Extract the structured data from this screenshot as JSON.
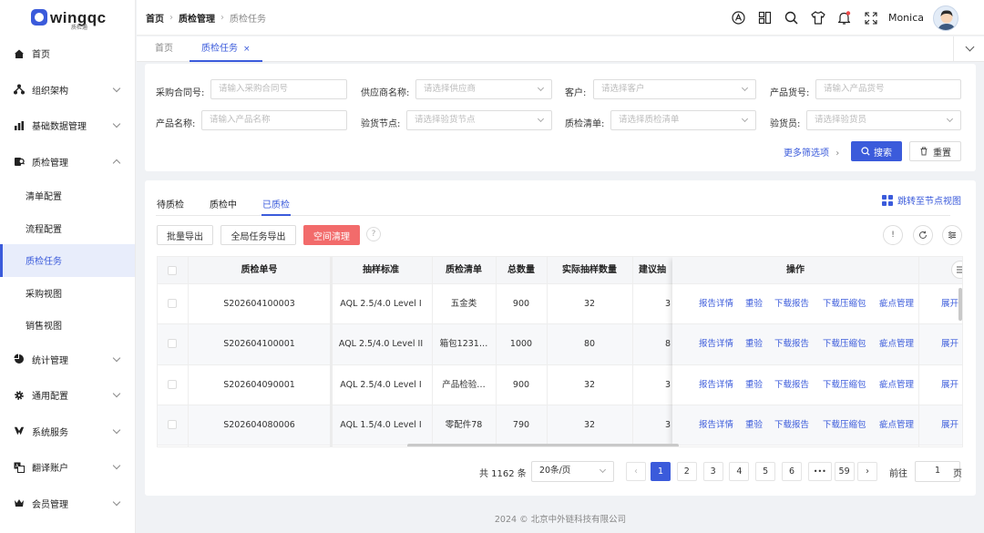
{
  "app": {
    "logo_text": "wingqc",
    "logo_sub": "质检通"
  },
  "sidebar": {
    "items": [
      {
        "label": "首页",
        "icon": "home-icon"
      },
      {
        "label": "组织架构",
        "icon": "org-icon"
      },
      {
        "label": "基础数据管理",
        "icon": "bar-chart-icon"
      },
      {
        "label": "质检管理",
        "icon": "inspect-icon"
      },
      {
        "label": "统计管理",
        "icon": "pie-icon"
      },
      {
        "label": "通用配置",
        "icon": "gear-icon"
      },
      {
        "label": "系统服务",
        "icon": "service-icon"
      },
      {
        "label": "翻译账户",
        "icon": "translate-icon"
      },
      {
        "label": "会员管理",
        "icon": "crown-icon"
      }
    ],
    "sub_items": [
      "清单配置",
      "流程配置",
      "质检任务",
      "采购视图",
      "销售视图"
    ],
    "active_sub": "质检任务"
  },
  "header": {
    "breadcrumb": [
      "首页",
      "质检管理",
      "质检任务"
    ],
    "user_name": "Monica"
  },
  "tabs": [
    {
      "label": "首页"
    },
    {
      "label": "质检任务",
      "close": "×"
    }
  ],
  "filters": {
    "contract_label": "采购合同号:",
    "contract_ph": "请输入采购合同号",
    "supplier_label": "供应商名称:",
    "supplier_ph": "请选择供应商",
    "customer_label": "客户:",
    "customer_ph": "请选择客户",
    "product_no_label": "产品货号:",
    "product_no_ph": "请输入产品货号",
    "product_name_label": "产品名称:",
    "product_name_ph": "请输入产品名称",
    "node_label": "验货节点:",
    "node_ph": "请选择验货节点",
    "list_label": "质检清单:",
    "list_ph": "请选择质检清单",
    "inspector_label": "验货员:",
    "inspector_ph": "请选择验货员",
    "more": "更多筛选项",
    "search": "搜索",
    "reset": "重置"
  },
  "status_tabs": [
    "待质检",
    "质检中",
    "已质检"
  ],
  "active_status_tab": "已质检",
  "jump_label": "跳转至节点视图",
  "actions": {
    "batch_export": "批量导出",
    "global_export": "全局任务导出",
    "space_clean": "空间清理"
  },
  "table": {
    "columns": [
      "质检单号",
      "抽样标准",
      "质检清单",
      "总数量",
      "实际抽样数量",
      "建议抽",
      "操作"
    ],
    "rows": [
      {
        "no": "S202604100003",
        "std": "AQL 2.5/4.0 Level I",
        "list": "五金类",
        "total": "900",
        "sample": "32",
        "suggest": "3"
      },
      {
        "no": "S202604100001",
        "std": "AQL 2.5/4.0 Level II",
        "list": "箱包1231…",
        "total": "1000",
        "sample": "80",
        "suggest": "8"
      },
      {
        "no": "S202604090001",
        "std": "AQL 2.5/4.0 Level I",
        "list": "产品检验…",
        "total": "900",
        "sample": "32",
        "suggest": "3"
      },
      {
        "no": "S202604080006",
        "std": "AQL 1.5/4.0 Level I",
        "list": "零配件78",
        "total": "790",
        "sample": "32",
        "suggest": "3"
      }
    ],
    "ops": [
      "报告详情",
      "重验",
      "下载报告",
      "下载压缩包",
      "疵点管理",
      "展开"
    ]
  },
  "pagination": {
    "total": "共 1162 条",
    "page_size": "20条/页",
    "pages": [
      "1",
      "2",
      "3",
      "4",
      "5",
      "6",
      "•••",
      "59"
    ],
    "current": "1",
    "goto_label": "前往",
    "goto_value": "1",
    "page_unit": "页"
  },
  "footer": "2024 © 北京中外链科技有限公司",
  "colors": {
    "primary": "#3b5bdb",
    "danger": "#f26b6b"
  }
}
